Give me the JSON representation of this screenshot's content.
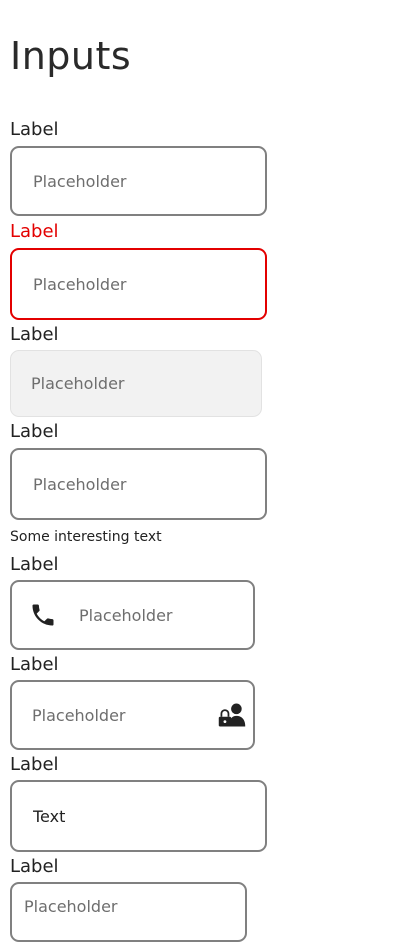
{
  "page": {
    "title": "Inputs"
  },
  "inputs": [
    {
      "label": "Label",
      "placeholder": "Placeholder",
      "value": ""
    },
    {
      "label": "Label",
      "placeholder": "Placeholder",
      "value": "",
      "state": "error"
    },
    {
      "label": "Label",
      "placeholder": "Placeholder",
      "value": "",
      "state": "disabled"
    },
    {
      "label": "Label",
      "placeholder": "Placeholder",
      "value": "",
      "helper": "Some interesting text"
    },
    {
      "label": "Label",
      "placeholder": "Placeholder",
      "value": "",
      "icon": "phone-icon"
    },
    {
      "label": "Label",
      "placeholder": "Placeholder",
      "value": "",
      "icon": "user-lock-icon"
    },
    {
      "label": "Label",
      "placeholder": "",
      "value": "Text"
    },
    {
      "label": "Label",
      "placeholder": "Placeholder",
      "value": ""
    }
  ],
  "colors": {
    "border": "#808080",
    "error": "#e30000",
    "disabled_bg": "#f2f2f2",
    "text": "#222222",
    "placeholder": "#6e6e6e"
  }
}
